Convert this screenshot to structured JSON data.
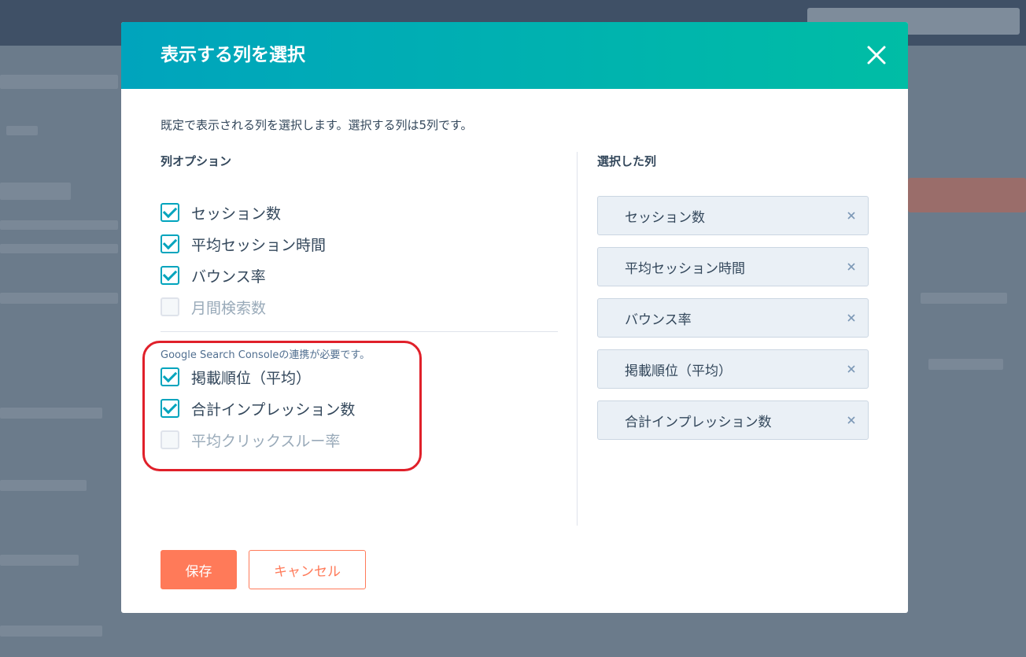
{
  "modal": {
    "title": "表示する列を選択",
    "description": "既定で表示される列を選択します。選択する列は5列です。"
  },
  "options": {
    "title": "列オプション",
    "items": [
      {
        "label": "セッション数",
        "checked": true,
        "disabled": false
      },
      {
        "label": "平均セッション時間",
        "checked": true,
        "disabled": false
      },
      {
        "label": "バウンス率",
        "checked": true,
        "disabled": false
      },
      {
        "label": "月間検索数",
        "checked": false,
        "disabled": true
      }
    ],
    "gsc_note": "Google Search Consoleの連携が必要です。",
    "gsc_items": [
      {
        "label": "掲載順位（平均）",
        "checked": true,
        "disabled": false
      },
      {
        "label": "合計インプレッション数",
        "checked": true,
        "disabled": false
      },
      {
        "label": "平均クリックスルー率",
        "checked": false,
        "disabled": true
      }
    ]
  },
  "selected": {
    "title": "選択した列",
    "items": [
      {
        "label": "セッション数"
      },
      {
        "label": "平均セッション時間"
      },
      {
        "label": "バウンス率"
      },
      {
        "label": "掲載順位（平均）"
      },
      {
        "label": "合計インプレッション数"
      }
    ]
  },
  "buttons": {
    "save": "保存",
    "cancel": "キャンセル"
  },
  "colors": {
    "header_start": "#00a4bd",
    "header_end": "#00bda5",
    "checkbox": "#00a4bd",
    "primary": "#ff7a59",
    "highlight": "#e0202a"
  }
}
